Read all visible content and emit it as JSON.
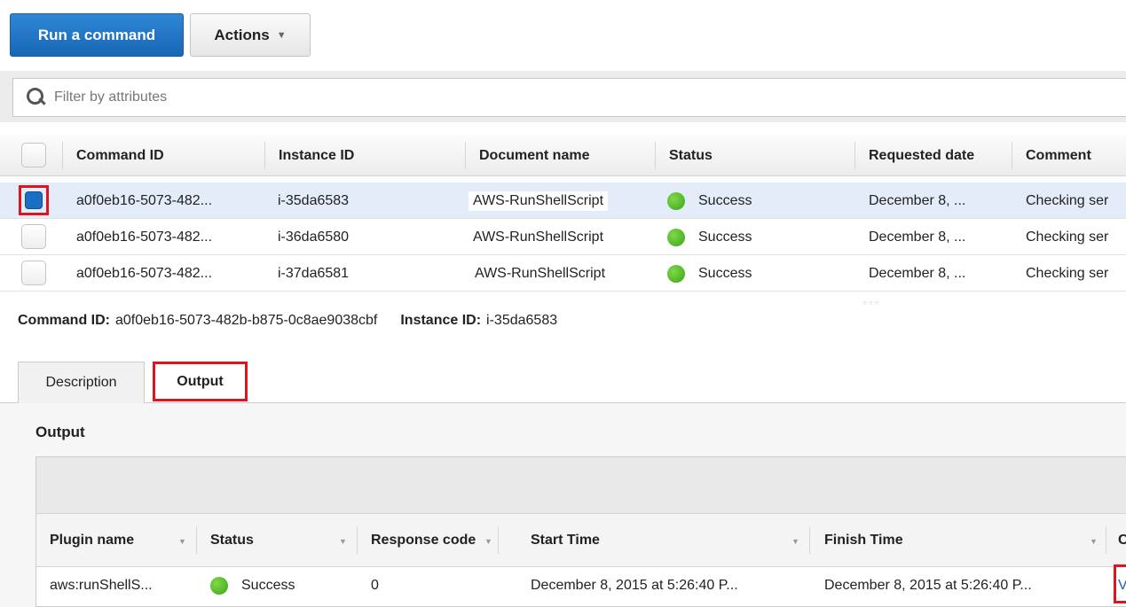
{
  "toolbar": {
    "run_command_label": "Run a command",
    "actions_label": "Actions"
  },
  "filter": {
    "placeholder": "Filter by attributes"
  },
  "commands_table": {
    "columns": [
      "Command ID",
      "Instance ID",
      "Document name",
      "Status",
      "Requested date",
      "Comment"
    ],
    "rows": [
      {
        "command_id": "a0f0eb16-5073-482...",
        "instance_id": "i-35da6583",
        "document": "AWS-RunShellScript",
        "status": "Success",
        "requested": "December 8, ...",
        "comment": "Checking ser",
        "selected": true
      },
      {
        "command_id": "a0f0eb16-5073-482...",
        "instance_id": "i-36da6580",
        "document": "AWS-RunShellScript",
        "status": "Success",
        "requested": "December 8, ...",
        "comment": "Checking ser",
        "selected": false
      },
      {
        "command_id": "a0f0eb16-5073-482...",
        "instance_id": "i-37da6581",
        "document": "AWS-RunShellScript",
        "status": "Success",
        "requested": "December 8, ...",
        "comment": "Checking ser",
        "selected": false
      }
    ]
  },
  "detail": {
    "command_id_label": "Command ID:",
    "command_id_value": "a0f0eb16-5073-482b-b875-0c8ae9038cbf",
    "instance_id_label": "Instance ID:",
    "instance_id_value": "i-35da6583"
  },
  "tabs": [
    {
      "label": "Description",
      "active": false
    },
    {
      "label": "Output",
      "active": true
    }
  ],
  "output": {
    "title": "Output",
    "columns": [
      "Plugin name",
      "Status",
      "Response code",
      "Start Time",
      "Finish Time",
      "C"
    ],
    "rows": [
      {
        "plugin": "aws:runShellS...",
        "status": "Success",
        "response_code": "0",
        "start": "December 8, 2015 at 5:26:40 P...",
        "finish": "December 8, 2015 at 5:26:40 P...",
        "output_link": "V"
      }
    ]
  },
  "colors": {
    "primary": "#1a6fc4",
    "success": "#3aa516",
    "highlight": "#e0141e",
    "selected_row": "#e3ecf8"
  }
}
